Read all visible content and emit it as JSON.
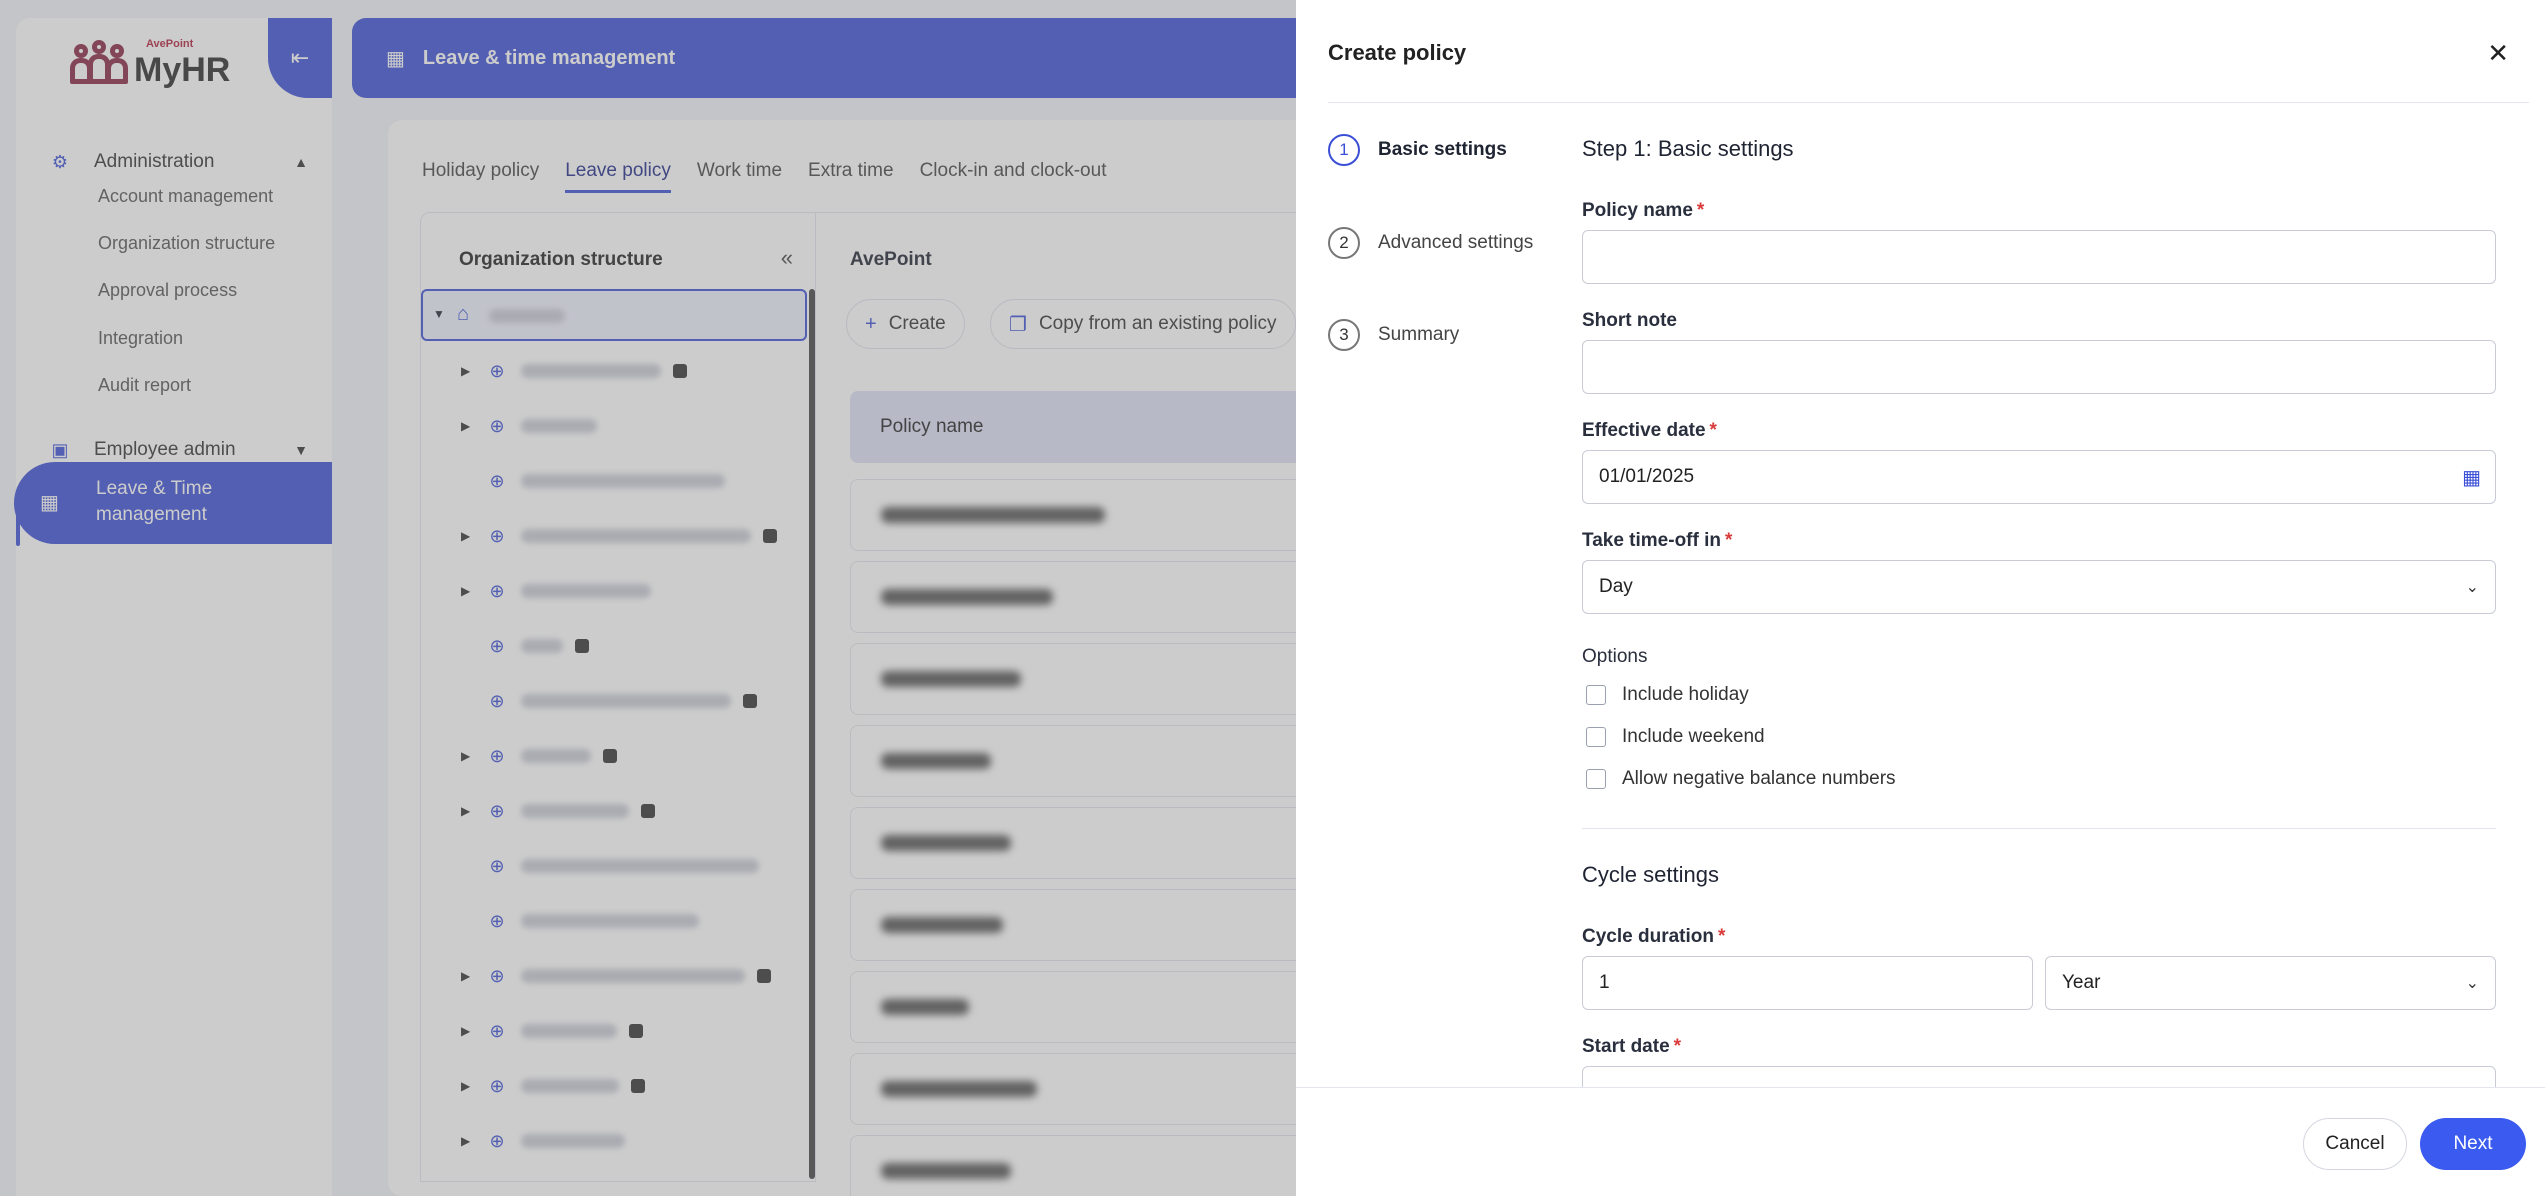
{
  "app": {
    "logo_small": "AvePoint",
    "logo_text": "MyHR",
    "topbar_title": "Leave & time management"
  },
  "sidebar": {
    "sections": [
      {
        "label": "Administration",
        "icon": "gear-icon"
      },
      {
        "label": "Employee admin",
        "icon": "badge-icon"
      }
    ],
    "admin_items": [
      "Account management",
      "Organization structure",
      "Approval process",
      "Integration",
      "Audit report"
    ],
    "active_item": {
      "label": "Leave & Time management",
      "icon": "calendar-icon"
    }
  },
  "tabs": [
    "Holiday policy",
    "Leave policy",
    "Work time",
    "Extra time",
    "Clock-in and clock-out"
  ],
  "active_tab": "Leave policy",
  "org_panel": {
    "title": "Organization structure"
  },
  "policy_panel": {
    "title": "AvePoint",
    "create_label": "Create",
    "copy_label": "Copy from an existing policy",
    "column_header": "Policy name"
  },
  "drawer": {
    "title": "Create policy",
    "steps": [
      {
        "num": "1",
        "label": "Basic settings"
      },
      {
        "num": "2",
        "label": "Advanced settings"
      },
      {
        "num": "3",
        "label": "Summary"
      }
    ],
    "step_heading": "Step 1: Basic settings",
    "fields": {
      "policy_name": {
        "label": "Policy name",
        "value": ""
      },
      "short_note": {
        "label": "Short note",
        "value": ""
      },
      "effective_date": {
        "label": "Effective date",
        "value": "01/01/2025"
      },
      "time_off_in": {
        "label": "Take time-off in",
        "value": "Day"
      }
    },
    "required_mark": "*",
    "options_label": "Options",
    "options": [
      "Include holiday",
      "Include weekend",
      "Allow negative balance numbers"
    ],
    "cycle_heading": "Cycle settings",
    "cycle_duration": {
      "label": "Cycle duration",
      "number": "1",
      "unit": "Year"
    },
    "start_date": {
      "label": "Start date"
    },
    "cancel_label": "Cancel",
    "next_label": "Next"
  }
}
